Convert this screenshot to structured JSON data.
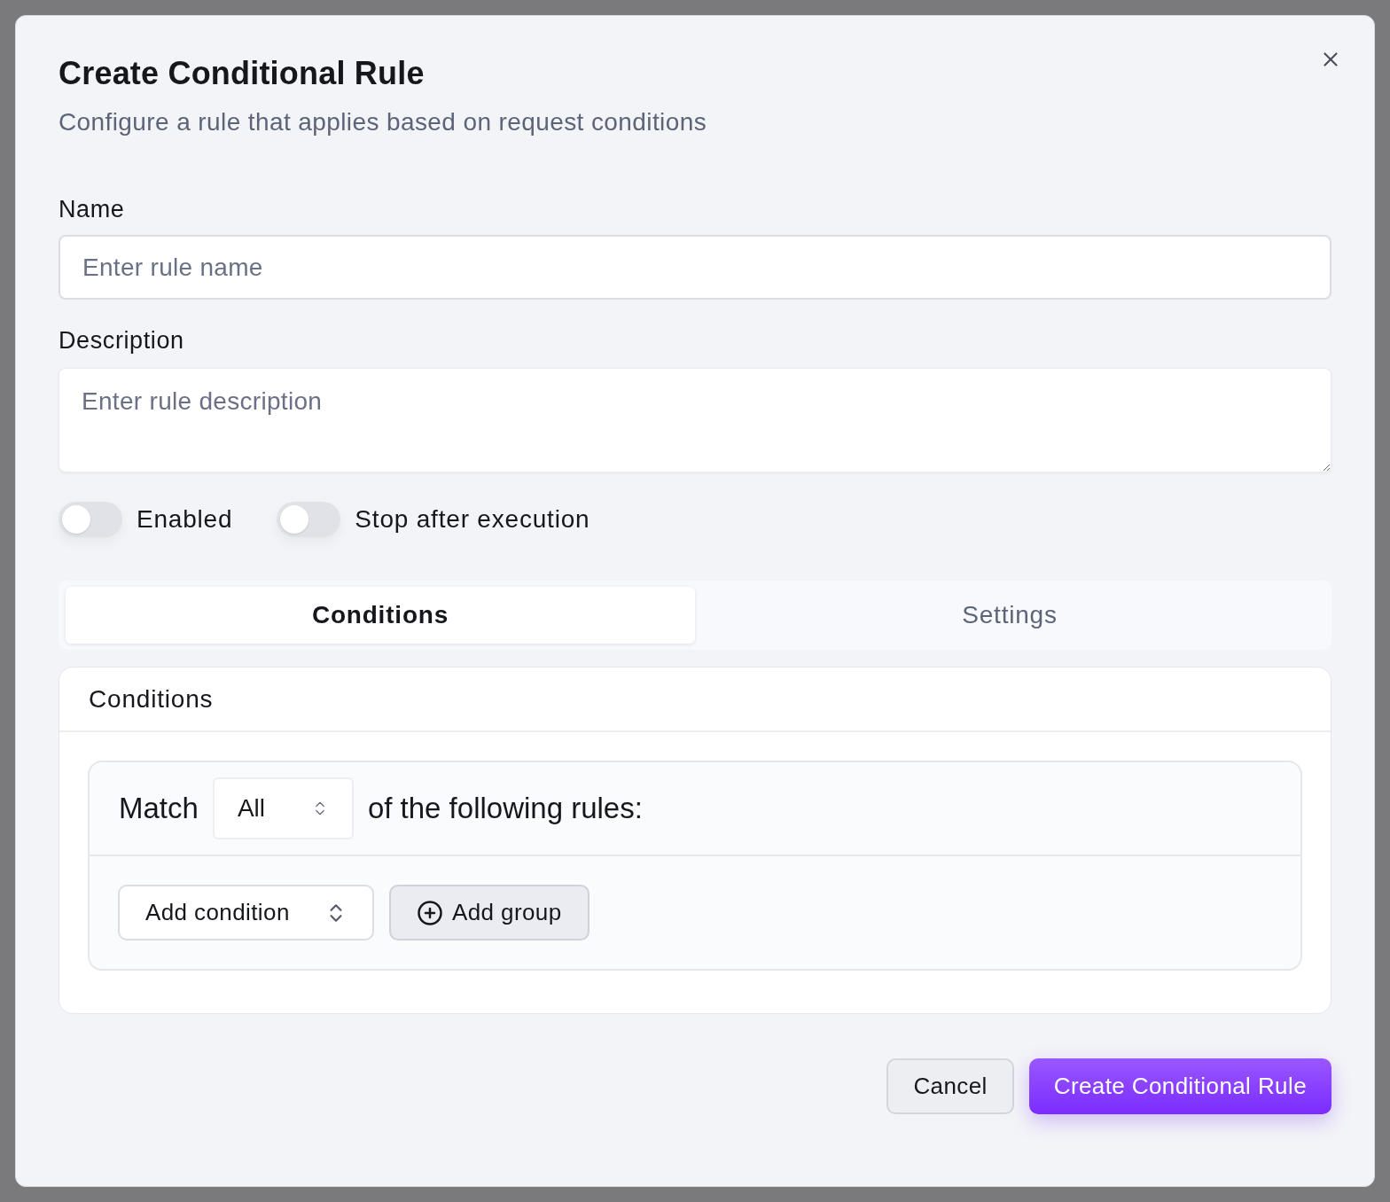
{
  "dialog": {
    "title": "Create Conditional Rule",
    "subtitle": "Configure a rule that applies based on request conditions"
  },
  "fields": [
    {
      "kind": "input",
      "label": "Name",
      "placeholder": "Enter rule name"
    },
    {
      "kind": "textarea",
      "label": "Description",
      "placeholder": "Enter rule description"
    }
  ],
  "toggles": [
    {
      "label": "Enabled",
      "on": false
    },
    {
      "label": "Stop after execution",
      "on": false
    }
  ],
  "tabs": [
    {
      "label": "Conditions",
      "selected": true
    },
    {
      "label": "Settings",
      "selected": false
    }
  ],
  "conditions_card": {
    "title": "Conditions",
    "match_label": "Match",
    "match_value": "All",
    "match_suffix": "of the following rules:",
    "add_condition": "Add condition",
    "add_group": "Add group"
  },
  "buttons": [
    {
      "kind": "secondary",
      "label": "Cancel"
    },
    {
      "kind": "primary",
      "label": "Create Conditional Rule"
    }
  ]
}
